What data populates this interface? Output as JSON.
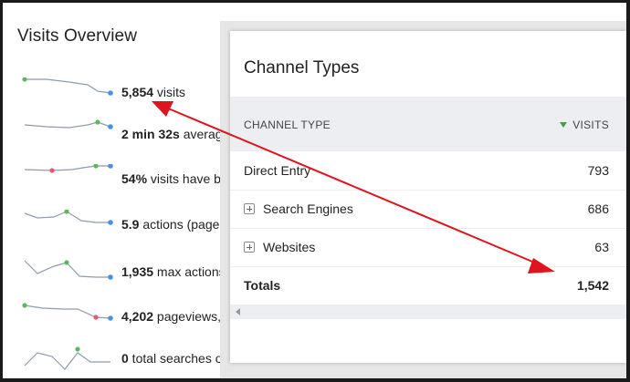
{
  "overview": {
    "title": "Visits Overview",
    "rows": [
      {
        "value": "5,854",
        "text": " visits",
        "last_dot": "#4a90e2"
      },
      {
        "value": "2 min 32s",
        "text": " averag",
        "last_dot": "#4a90e2"
      },
      {
        "value": "54%",
        "text": " visits have bo",
        "last_dot": "#4a90e2"
      },
      {
        "value": "5.9",
        "text": " actions (page",
        "last_dot": "#4a90e2"
      },
      {
        "value": "1,935",
        "text": " max actions",
        "last_dot": "#4a90e2"
      },
      {
        "value": "4,202",
        "text": " pageviews,",
        "last_dot": "#4a90e2"
      },
      {
        "value": "0",
        "text": " total searches o",
        "last_dot": "#4a90e2"
      }
    ]
  },
  "channel_types": {
    "title": "Channel Types",
    "header": {
      "label": "CHANNEL TYPE",
      "visits": "VISITS"
    },
    "rows": [
      {
        "label": "Direct Entry",
        "value": "793",
        "expandable": false
      },
      {
        "label": "Search Engines",
        "value": "686",
        "expandable": true
      },
      {
        "label": "Websites",
        "value": "63",
        "expandable": true
      }
    ],
    "totals": {
      "label": "Totals",
      "value": "1,542"
    }
  },
  "colors": {
    "sparkline": "#8e9bb0",
    "dot_green": "#5cb85c",
    "dot_red": "#e8596e",
    "dot_blue": "#4a90e2",
    "sort_icon": "#43a047",
    "annotation_arrow": "#e0141e"
  }
}
